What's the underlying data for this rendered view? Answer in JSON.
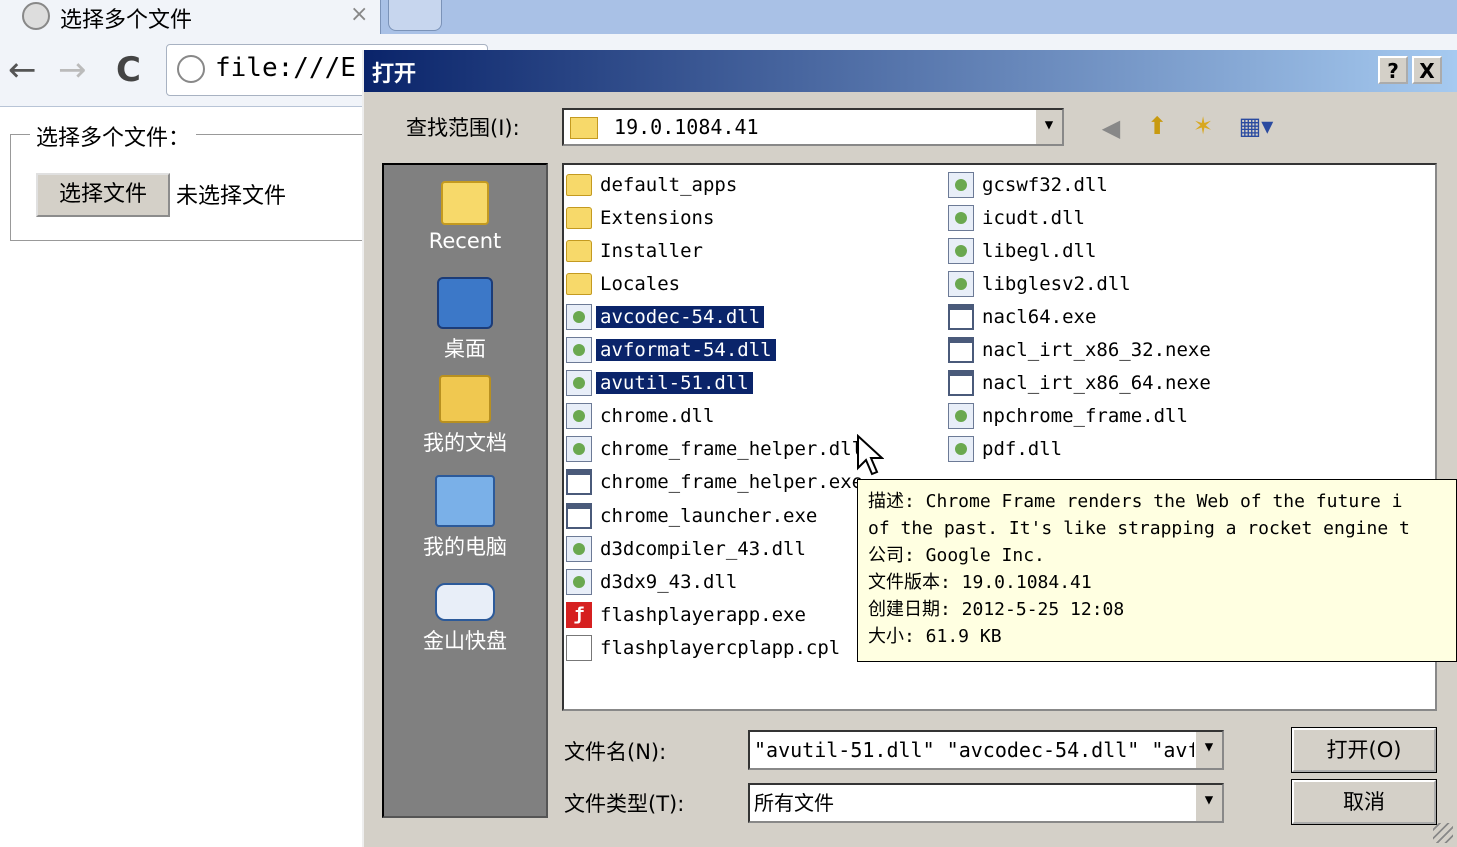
{
  "browser": {
    "tab_title": "选择多个文件",
    "tab_close": "×",
    "back": "←",
    "forward": "→",
    "reload": "C",
    "url": "file:///E"
  },
  "page": {
    "legend": "选择多个文件：",
    "choose_button": "选择文件",
    "no_file": "未选择文件"
  },
  "dialog": {
    "title": "打开",
    "help": "?",
    "close": "X",
    "look_in_label": "查找范围(I):",
    "look_in_value": "19.0.1084.41",
    "places": [
      {
        "label": "Recent",
        "icon": "recent-folder-icon"
      },
      {
        "label": "桌面",
        "icon": "desktop-icon"
      },
      {
        "label": "我的文档",
        "icon": "my-documents-icon"
      },
      {
        "label": "我的电脑",
        "icon": "my-computer-icon"
      },
      {
        "label": "金山快盘",
        "icon": "kuaipan-drive-icon"
      }
    ],
    "files_left": [
      {
        "name": "default_apps",
        "type": "folder",
        "selected": false
      },
      {
        "name": "Extensions",
        "type": "folder",
        "selected": false
      },
      {
        "name": "Installer",
        "type": "folder",
        "selected": false
      },
      {
        "name": "Locales",
        "type": "folder",
        "selected": false
      },
      {
        "name": "avcodec-54.dll",
        "type": "dll",
        "selected": true
      },
      {
        "name": "avformat-54.dll",
        "type": "dll",
        "selected": true
      },
      {
        "name": "avutil-51.dll",
        "type": "dll",
        "selected": true
      },
      {
        "name": "chrome.dll",
        "type": "dll",
        "selected": false
      },
      {
        "name": "chrome_frame_helper.dll",
        "type": "dll",
        "selected": false
      },
      {
        "name": "chrome_frame_helper.exe",
        "type": "exe",
        "selected": false
      },
      {
        "name": "chrome_launcher.exe",
        "type": "exe",
        "selected": false
      },
      {
        "name": "d3dcompiler_43.dll",
        "type": "dll",
        "selected": false
      },
      {
        "name": "d3dx9_43.dll",
        "type": "dll",
        "selected": false
      },
      {
        "name": "flashplayerapp.exe",
        "type": "flash",
        "selected": false
      },
      {
        "name": "flashplayercplapp.cpl",
        "type": "cpl",
        "selected": false
      }
    ],
    "files_right": [
      {
        "name": "gcswf32.dll",
        "type": "dll"
      },
      {
        "name": "icudt.dll",
        "type": "dll"
      },
      {
        "name": "libegl.dll",
        "type": "dll"
      },
      {
        "name": "libglesv2.dll",
        "type": "dll"
      },
      {
        "name": "nacl64.exe",
        "type": "exe"
      },
      {
        "name": "nacl_irt_x86_32.nexe",
        "type": "exe"
      },
      {
        "name": "nacl_irt_x86_64.nexe",
        "type": "exe"
      },
      {
        "name": "npchrome_frame.dll",
        "type": "dll"
      },
      {
        "name": "pdf.dll",
        "type": "dll"
      }
    ],
    "tooltip": {
      "line1": "描述: Chrome Frame renders the Web of the future i",
      "line2": "of the past. It's like strapping a rocket engine t",
      "line3": "公司: Google Inc.",
      "line4": "文件版本: 19.0.1084.41",
      "line5": "创建日期: 2012-5-25 12:08",
      "line6": "大小: 61.9 KB"
    },
    "filename_label": "文件名(N):",
    "filename_value": "\"avutil-51.dll\" \"avcodec-54.dll\" \"avf",
    "filetype_label": "文件类型(T):",
    "filetype_value": "所有文件",
    "open_button": "打开(O)",
    "cancel_button": "取消"
  }
}
